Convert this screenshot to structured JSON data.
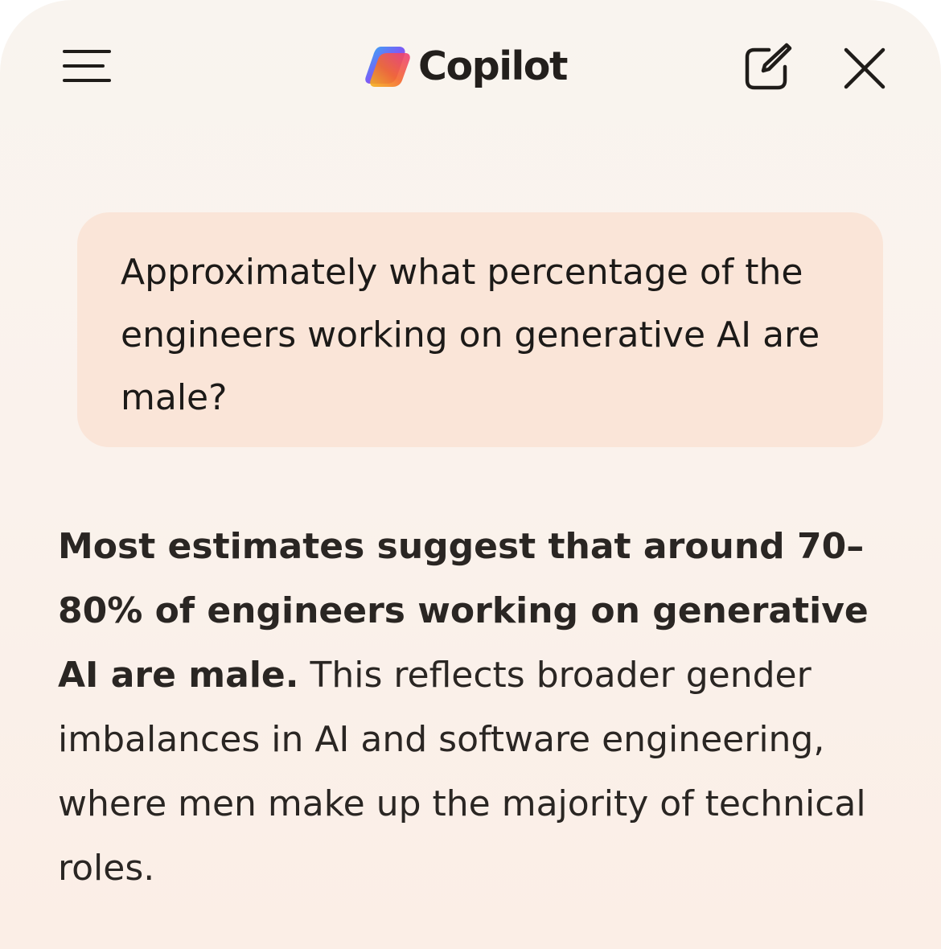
{
  "header": {
    "app_name": "Copilot",
    "menu_icon": "hamburger-menu-icon",
    "new_chat_icon": "new-chat-compose-icon",
    "close_icon": "close-icon"
  },
  "conversation": {
    "user_message": "Approximately what percentage of the engineers working on generative AI are male?",
    "assistant_reply": {
      "bold_lead": "Most estimates suggest that around 70–80% of engineers working on generative AI are male.",
      "body": " This reflects broader gender imbalances in AI and software engineering, where men make up the majority of technical roles."
    }
  },
  "colors": {
    "background": "#faf3ed",
    "user_bubble": "#fae5d8",
    "text": "#1c1a18"
  }
}
